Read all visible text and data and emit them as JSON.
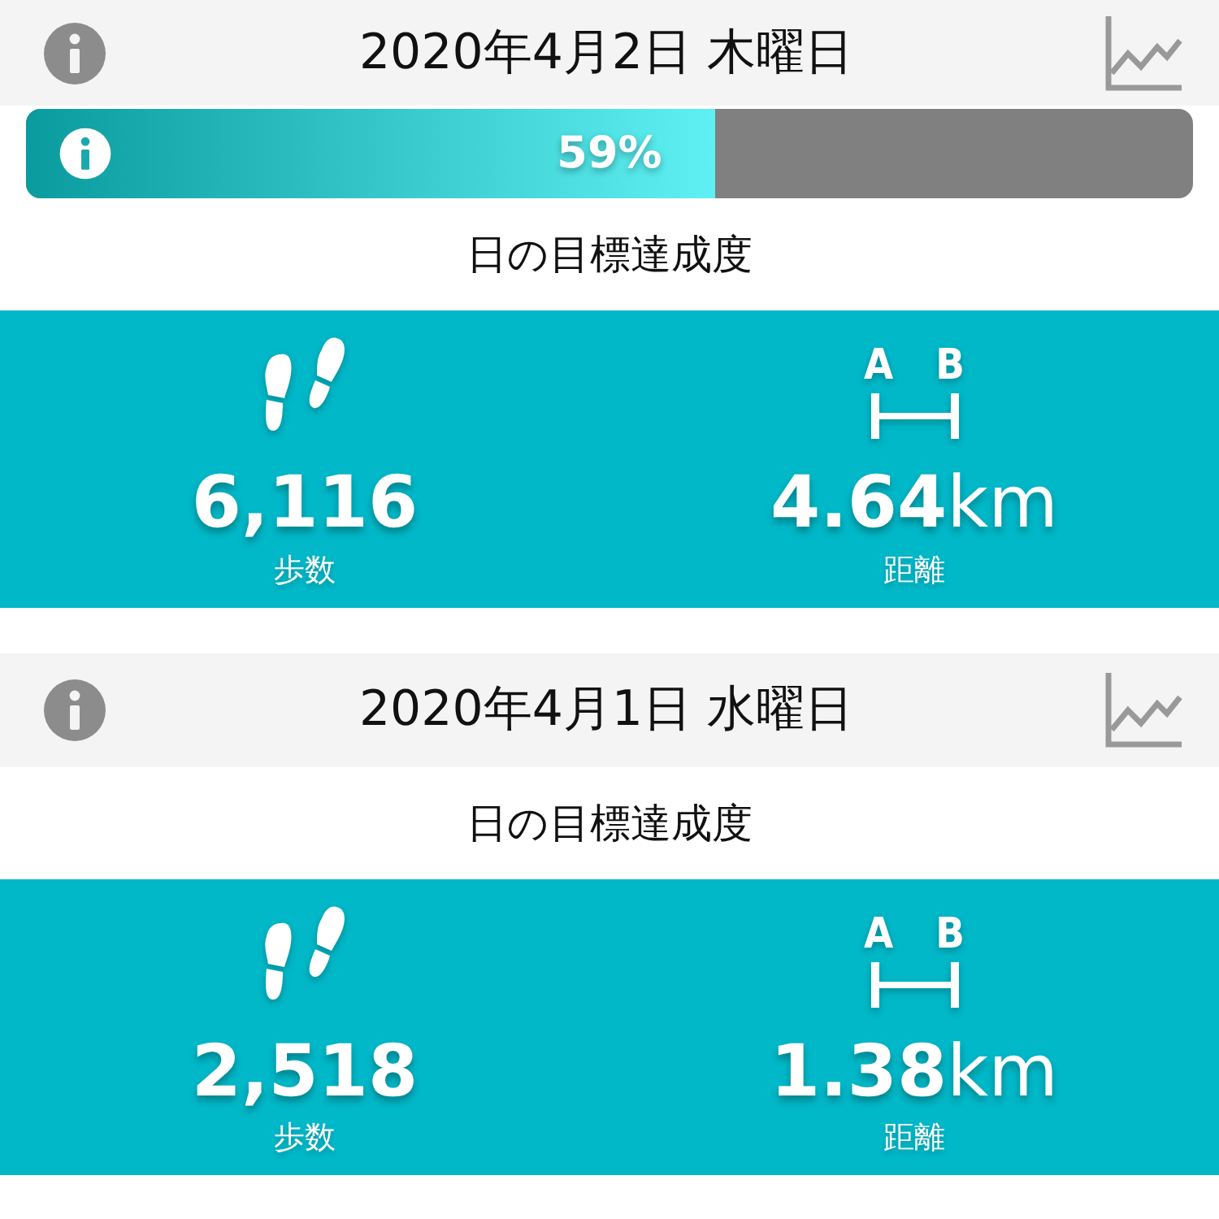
{
  "days": [
    {
      "date": "2020年4月2日 木曜日",
      "progress": {
        "level": 0.59,
        "reading": "59%"
      },
      "goal_label": "日の目標達成度",
      "stats": [
        {
          "kind": "steps",
          "value": "6,116",
          "label": "歩数"
        },
        {
          "kind": "distance",
          "value": "4.64",
          "unit": "km",
          "label": "距離",
          "from": "A",
          "to": "B"
        }
      ]
    },
    {
      "date": "2020年4月1日 水曜日",
      "goal_label": "日の目標達成度",
      "stats": [
        {
          "kind": "steps",
          "value": "2,518",
          "label": "歩数"
        },
        {
          "kind": "distance",
          "value": "1.38",
          "unit": "km",
          "label": "距離",
          "from": "A",
          "to": "B"
        }
      ]
    }
  ]
}
